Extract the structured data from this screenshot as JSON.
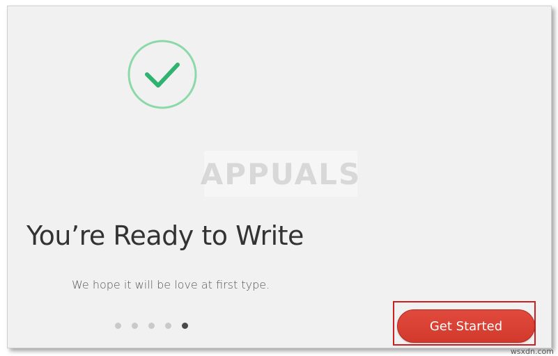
{
  "icons": {
    "success": "check-circle-icon"
  },
  "colors": {
    "check": "#2fb370",
    "circle": "#8bd9a9",
    "button": "#d9402f",
    "highlight": "#cc1f1f",
    "dot_active": "#4a4a4a",
    "dot_inactive": "#c9c9c9"
  },
  "watermark": {
    "text": "APPUALS"
  },
  "main": {
    "title": "You’re Ready to Write",
    "subtitle": "We hope it will be love at first type.",
    "cta_label": "Get Started"
  },
  "pagination": {
    "total": 5,
    "active_index": 4
  },
  "footer": {
    "source_mark": "wsxdn.com"
  }
}
